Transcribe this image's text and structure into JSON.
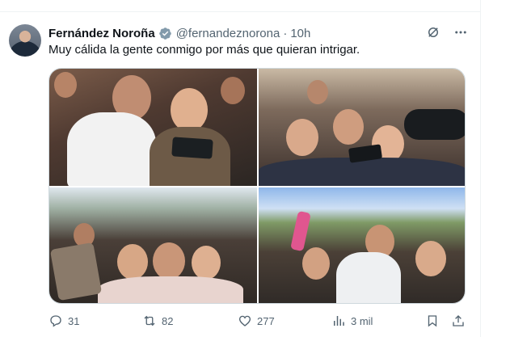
{
  "tweet": {
    "author_name": "Fernández Noroña",
    "handle": "@fernandeznorona",
    "separator": "·",
    "time": "10h",
    "text": "Muy cálida la gente conmigo por más que quieran intrigar.",
    "verified": true
  },
  "media": {
    "photos": [
      {
        "name": "photo-1"
      },
      {
        "name": "photo-2"
      },
      {
        "name": "photo-3"
      },
      {
        "name": "photo-4"
      }
    ]
  },
  "actions": {
    "replies": "31",
    "reposts": "82",
    "likes": "277",
    "views": "3 mil"
  },
  "icons": {
    "verified": "verified-badge-icon",
    "grok": "grok-icon",
    "more": "more-icon",
    "reply": "reply-icon",
    "repost": "repost-icon",
    "like": "like-icon",
    "views": "views-icon",
    "bookmark": "bookmark-icon",
    "share": "share-icon"
  },
  "colors": {
    "text": "#0f1419",
    "secondary": "#536471",
    "verified": "#829aab",
    "border": "#eff3f4"
  }
}
